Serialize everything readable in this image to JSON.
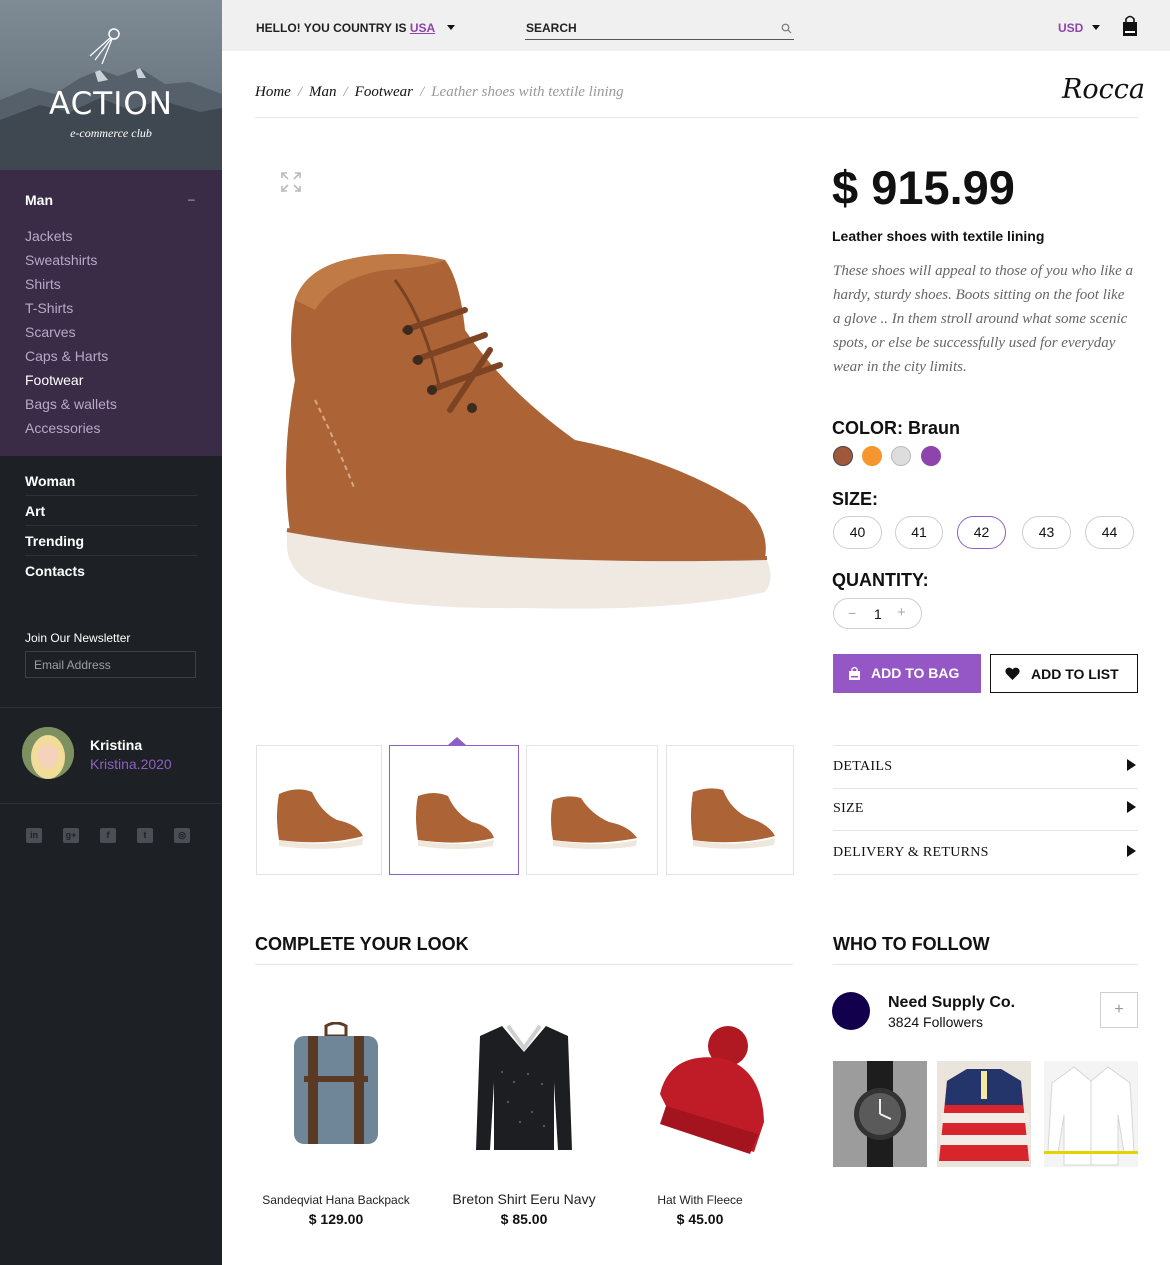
{
  "sidebar": {
    "logo_title": "ACTION",
    "logo_subtitle": "e-commerce club",
    "category": {
      "title": "Man",
      "toggle": "–",
      "items": [
        "Jackets",
        "Sweatshirts",
        "Shirts",
        "T-Shirts",
        "Scarves",
        "Caps & Harts",
        "Footwear",
        "Bags & wallets",
        "Accessories"
      ],
      "active": "Footwear"
    },
    "nav": [
      "Woman",
      "Art",
      "Trending",
      "Contacts"
    ],
    "newsletter": {
      "title": "Join Our Newsletter",
      "placeholder": "Email Address"
    },
    "user": {
      "name": "Kristina",
      "handle": "Kristina.2020"
    },
    "socials": [
      "linkedin-icon",
      "google-plus-icon",
      "facebook-icon",
      "twitter-icon",
      "instagram-icon"
    ]
  },
  "topbar": {
    "country_prefix": "HELLO! YOU COUNTRY IS",
    "country": "USA",
    "search_placeholder": "SEARCH",
    "currency": "USD"
  },
  "breadcrumb": [
    "Home",
    "Man",
    "Footwear",
    "Leather shoes with textile lining"
  ],
  "brand": "Rocca",
  "product": {
    "price": "$ 915.99",
    "name": "Leather shoes with textile lining",
    "description": "These shoes will appeal to those of you who like a hardy, sturdy shoes. Boots sitting on the foot like a glove .. In them stroll around what some scenic spots, or else be successfully used for everyday wear in the city limits.",
    "color_label": "COLOR:",
    "color_value": "Braun",
    "colors": [
      "#a0583a",
      "#f5962e",
      "#dddddd",
      "#8e44ad"
    ],
    "size_label": "SIZE:",
    "sizes": [
      "40",
      "41",
      "42",
      "43",
      "44"
    ],
    "selected_size": "42",
    "quantity_label": "QUANTITY:",
    "quantity": "1",
    "add_to_bag": "ADD TO BAG",
    "add_to_list": "ADD TO LIST",
    "accordion": [
      "DETAILS",
      "SIZE",
      "DELIVERY & RETURNS"
    ]
  },
  "complete_look": {
    "title": "COMPLETE YOUR LOOK",
    "items": [
      {
        "name": "Sandeqviat Hana Backpack",
        "price": "$ 129.00"
      },
      {
        "name": "Breton Shirt Eeru Navy",
        "price": "$ 85.00"
      },
      {
        "name": "Hat With Fleece",
        "price": "$ 45.00"
      }
    ]
  },
  "who_to_follow": {
    "title": "WHO TO FOLLOW",
    "name": "Need Supply Co.",
    "followers": "3824 Followers",
    "follow_button": "+"
  },
  "colors": {
    "accent": "#8e44ad",
    "sidebar_dark": "#1d2024",
    "sidebar_purple": "#3a2b47"
  }
}
